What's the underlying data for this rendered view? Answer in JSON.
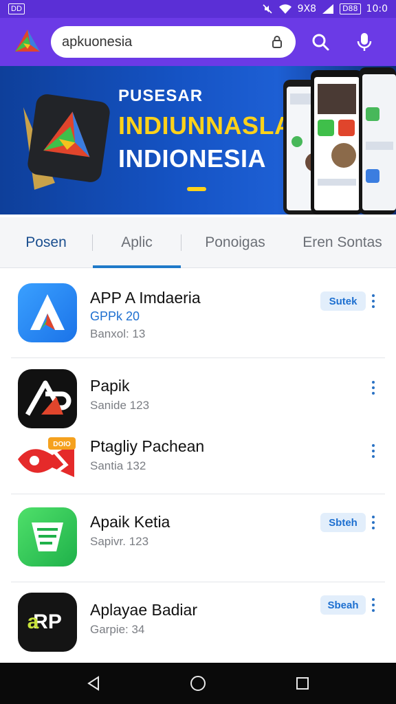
{
  "status_bar": {
    "left_badge": "DD",
    "signal_text": "9X8",
    "battery_text": "D88",
    "time": "10:0",
    "icons": [
      "mute-icon",
      "wifi-icon",
      "signal-icon",
      "battery-icon"
    ]
  },
  "app_bar": {
    "logo_icon": "app-logo-icon",
    "search": {
      "value": "apkuonesia"
    },
    "actions": [
      "search-icon",
      "mic-icon"
    ],
    "accent": "#6b3ae6"
  },
  "banner": {
    "kicker": "PUSESAR",
    "headline_1": "INDIUNNASLA",
    "headline_2": "INDIONESIA",
    "accent": "#ffd21a"
  },
  "tabs": [
    {
      "label": "Posen"
    },
    {
      "label": "Aplic"
    },
    {
      "label": "Ponoigas"
    },
    {
      "label": "Eren Sontas"
    }
  ],
  "apps": [
    {
      "title": "APP A Imdaeria",
      "sub1": "GPPk  20",
      "sub2": "Banxol: 13",
      "action": "Sutek",
      "icon": "app-a-icon"
    },
    {
      "title": "Papik",
      "sub1": "",
      "sub2": "Sanide 123",
      "action": "",
      "icon": "ap-logo-icon"
    },
    {
      "title": "Ptagliy Pachean",
      "sub1": "",
      "sub2": "Santia 132",
      "action": "",
      "icon": "fish-tag-icon"
    },
    {
      "title": "Apaik Ketia",
      "sub1": "",
      "sub2": "Sapivr. 123",
      "action": "Sbteh",
      "icon": "green-doc-icon"
    },
    {
      "title": "Aplayae Badiar",
      "sub1": "",
      "sub2": "Garpie: 34",
      "action": "Sbeah",
      "icon": "arp-icon"
    }
  ],
  "nav_bar": {
    "icons": [
      "back-icon",
      "home-icon",
      "recents-icon"
    ]
  }
}
